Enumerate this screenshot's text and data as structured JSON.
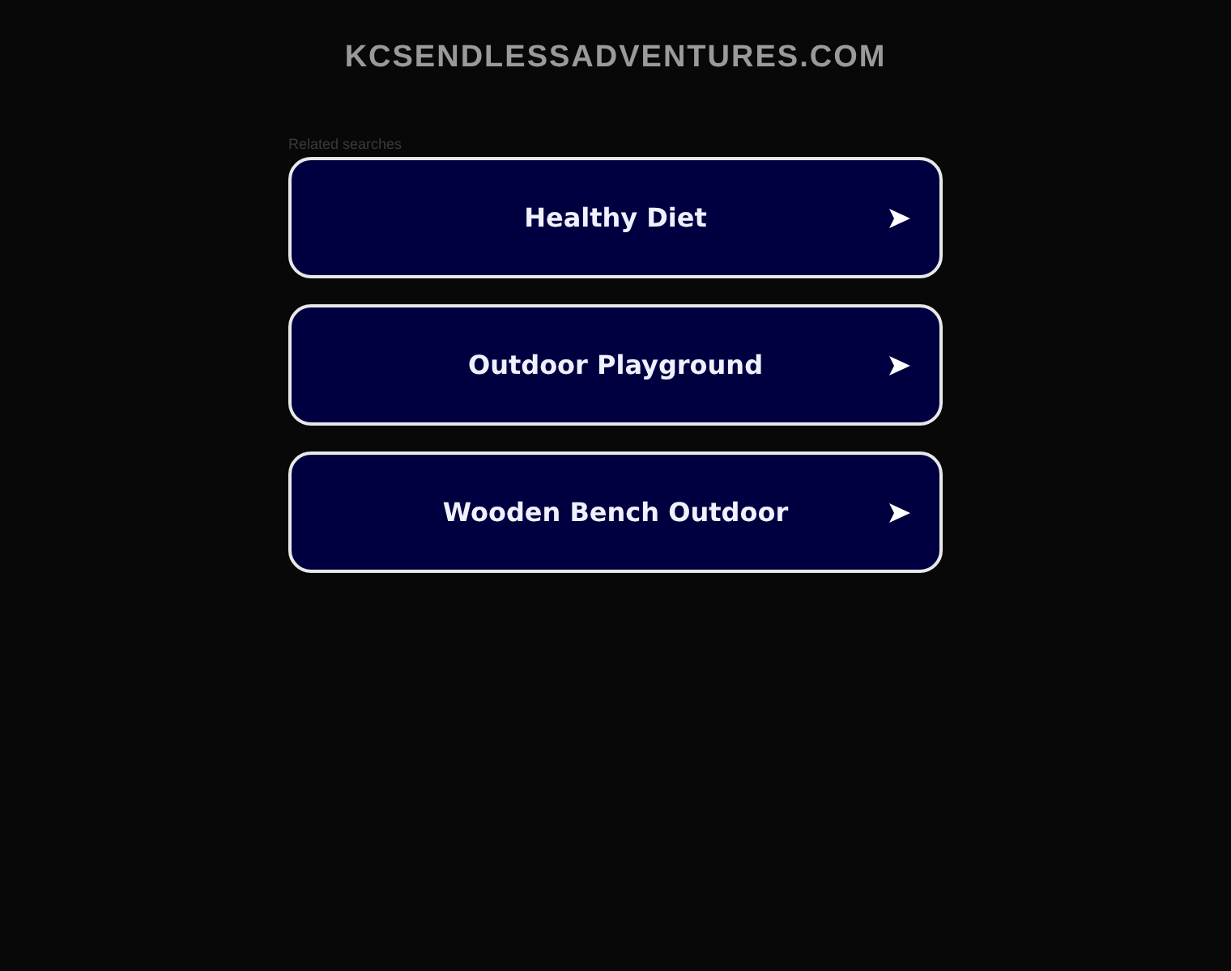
{
  "site_title": "KCSENDLESSADVENTURES.COM",
  "related_label": "Related searches",
  "links": [
    {
      "label": "Healthy Diet"
    },
    {
      "label": "Outdoor Playground"
    },
    {
      "label": "Wooden Bench Outdoor"
    }
  ]
}
